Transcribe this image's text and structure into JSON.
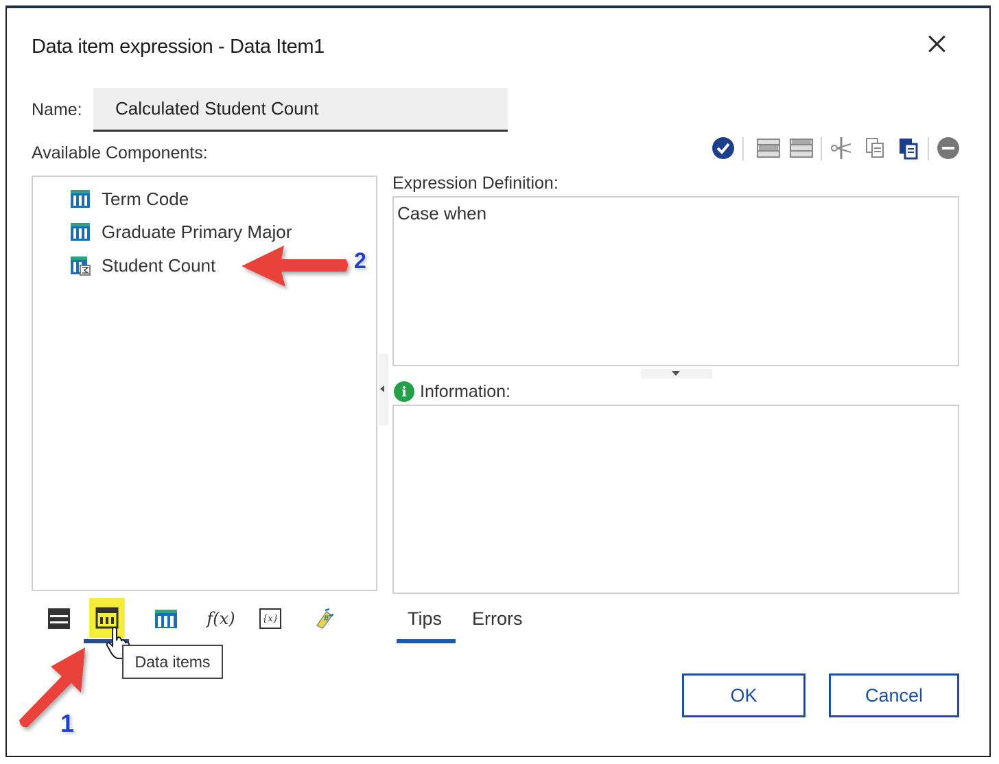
{
  "dialog": {
    "title": "Data item expression - Data Item1"
  },
  "name_field": {
    "label": "Name:",
    "value": "Calculated Student Count"
  },
  "available_components": {
    "label": "Available Components:",
    "items": [
      {
        "label": "Term Code",
        "icon": "data-item-icon"
      },
      {
        "label": "Graduate Primary Major",
        "icon": "data-item-icon"
      },
      {
        "label": "Student Count",
        "icon": "measure-data-item-icon"
      }
    ]
  },
  "toolbar": {
    "icons": [
      "validate-icon",
      "insert-row-above-icon",
      "insert-row-below-icon",
      "cut-icon",
      "copy-icon",
      "paste-icon",
      "delete-icon"
    ]
  },
  "expression": {
    "label": "Expression Definition:",
    "value": "Case when"
  },
  "information": {
    "label": "Information:",
    "icon_glyph": "i"
  },
  "bottom_tabs": {
    "icons": [
      "source-icon",
      "data-items-icon",
      "query-items-icon",
      "functions-icon",
      "parameters-icon",
      "macros-icon"
    ],
    "functions_glyph": "f(x)",
    "parameters_glyph": "{x}",
    "tooltip": "Data items"
  },
  "tip_tabs": {
    "tips": "Tips",
    "errors": "Errors"
  },
  "buttons": {
    "ok": "OK",
    "cancel": "Cancel"
  },
  "annotations": {
    "badge_1": "1",
    "badge_2": "2",
    "arrow_color": "#e8423a",
    "badge_color": "#1f3fcf"
  },
  "colors": {
    "accent": "#1c4fa0",
    "highlight": "#f4ed3a",
    "info": "#24a148",
    "item_icon": "#1a6fb8"
  }
}
